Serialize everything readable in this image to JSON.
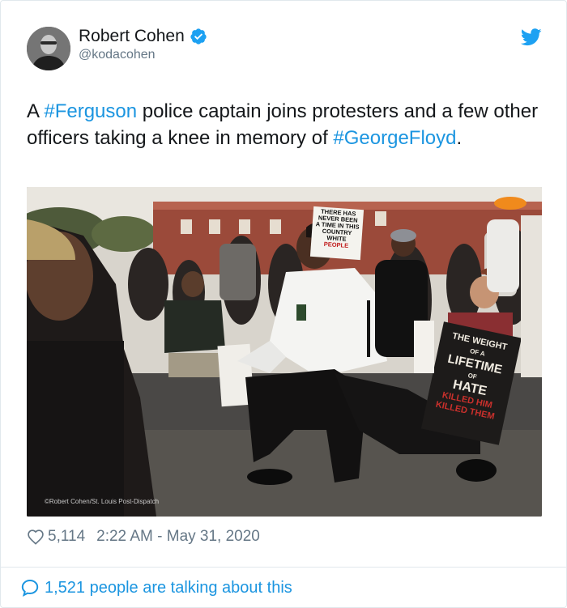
{
  "author": {
    "name": "Robert Cohen",
    "handle": "@kodacohen",
    "verified": true,
    "avatar_icon": "profile-photo"
  },
  "tweet": {
    "text_parts": [
      {
        "type": "text",
        "value": "A "
      },
      {
        "type": "hashtag",
        "value": "#Ferguson"
      },
      {
        "type": "text",
        "value": " police captain joins protesters and a few other officers taking a knee in memory of "
      },
      {
        "type": "hashtag",
        "value": "#GeorgeFloyd"
      },
      {
        "type": "text",
        "value": "."
      }
    ]
  },
  "photo": {
    "credit": "©Robert Cohen/St. Louis Post-Dispatch",
    "sign_text": [
      "THERE HAS",
      "NEVER BEEN",
      "A TIME IN THIS",
      "COUNTRY WHITE",
      "PEOPLE"
    ],
    "sign2_text": [
      "THE WEIGHT",
      "OF A",
      "LIFETIME",
      "OF",
      "HATE",
      "KILLED HIM",
      "KILLED THEM"
    ]
  },
  "meta": {
    "likes": "5,114",
    "timestamp": "2:22 AM - May 31, 2020"
  },
  "footer": {
    "talking": "1,521 people are talking about this"
  },
  "colors": {
    "accent": "#1b95e0",
    "verified": "#1da1f2",
    "muted": "#657786"
  }
}
